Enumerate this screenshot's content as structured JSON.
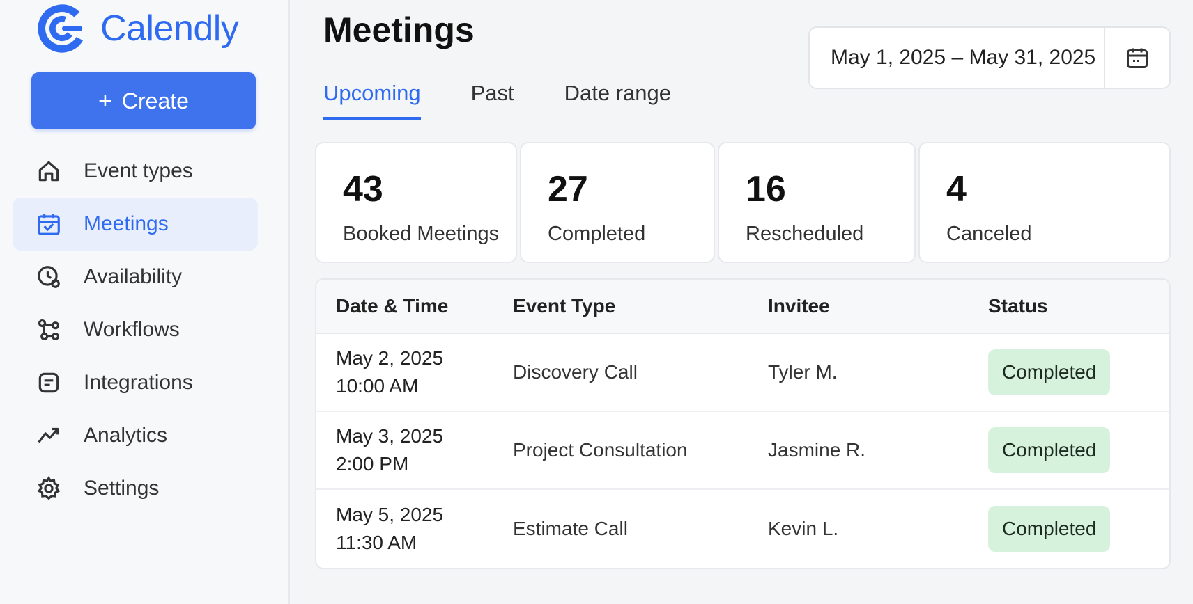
{
  "app": {
    "name": "Calendly",
    "brand_color": "#2f6bf0",
    "logo_icon": "calendly-logo-icon"
  },
  "sidebar": {
    "create_label": "Create",
    "items": [
      {
        "label": "Event types",
        "icon": "home-icon"
      },
      {
        "label": "Meetings",
        "icon": "calendar-icon",
        "active": true
      },
      {
        "label": "Availability",
        "icon": "clock-icon"
      },
      {
        "label": "Workflows",
        "icon": "workflow-icon"
      },
      {
        "label": "Integrations",
        "icon": "integrations-icon"
      },
      {
        "label": "Analytics",
        "icon": "analytics-icon"
      },
      {
        "label": "Settings",
        "icon": "gear-icon"
      }
    ]
  },
  "header": {
    "title": "Meetings",
    "date_range": "May 1, 2025 – May 31, 2025",
    "tabs": [
      {
        "label": "Upcoming",
        "active": true
      },
      {
        "label": "Past"
      },
      {
        "label": "Date range"
      }
    ]
  },
  "stats": [
    {
      "value": "43",
      "label": "Booked Meetings"
    },
    {
      "value": "27",
      "label": "Completed"
    },
    {
      "value": "16",
      "label": "Rescheduled"
    },
    {
      "value": "4",
      "label": "Canceled"
    }
  ],
  "table": {
    "columns": [
      "Date & Time",
      "Event Type",
      "Invitee",
      "Status"
    ],
    "rows": [
      {
        "date": "May 2, 2025",
        "time": "10:00 AM",
        "event": "Discovery Call",
        "invitee": "Tyler M.",
        "status": "Completed"
      },
      {
        "date": "May 3, 2025",
        "time": "2:00 PM",
        "event": "Project Consultation",
        "invitee": "Jasmine R.",
        "status": "Completed"
      },
      {
        "date": "May 5, 2025",
        "time": "11:30 AM",
        "event": "Estimate Call",
        "invitee": "Kevin L.",
        "status": "Completed"
      }
    ],
    "status_color": "#d7f2dc"
  }
}
